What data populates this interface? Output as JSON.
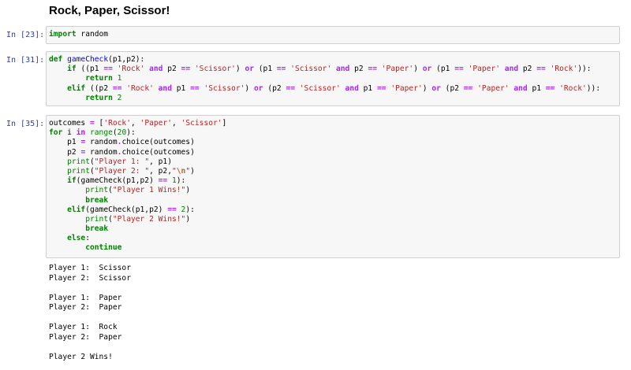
{
  "heading": "Rock, Paper, Scissor!",
  "cells": [
    {
      "prompt": "In [23]:"
    },
    {
      "prompt": "In [31]:"
    },
    {
      "prompt": "In [35]:"
    }
  ],
  "code": {
    "c1": [
      "import",
      " random"
    ],
    "c2": {
      "l1": [
        "def",
        " ",
        "gameCheck",
        "(p1,p2):"
      ],
      "l2": [
        "    ",
        "if",
        " ((p1 ",
        "==",
        " ",
        "'Rock'",
        " ",
        "and",
        " p2 ",
        "==",
        " ",
        "'Scissor'",
        ") ",
        "or",
        " (p1 ",
        "==",
        " ",
        "'Scissor'",
        " ",
        "and",
        " p2 ",
        "==",
        " ",
        "'Paper'",
        ") ",
        "or",
        " (p1 ",
        "==",
        " ",
        "'Paper'",
        " ",
        "and",
        " p2 ",
        "==",
        " ",
        "'Rock'",
        ")):"
      ],
      "l3": [
        "        ",
        "return",
        " ",
        "1"
      ],
      "l4": [
        "    ",
        "elif",
        " ((p2 ",
        "==",
        " ",
        "'Rock'",
        " ",
        "and",
        " p1 ",
        "==",
        " ",
        "'Scissor'",
        ") ",
        "or",
        " (p2 ",
        "==",
        " ",
        "'Scissor'",
        " ",
        "and",
        " p1 ",
        "==",
        " ",
        "'Paper'",
        ") ",
        "or",
        " (p2 ",
        "==",
        " ",
        "'Paper'",
        " ",
        "and",
        " p1 ",
        "==",
        " ",
        "'Rock'",
        ")):"
      ],
      "l5": [
        "        ",
        "return",
        " ",
        "2"
      ]
    },
    "c3": {
      "l1": [
        "outcomes ",
        "=",
        " [",
        "'Rock'",
        ", ",
        "'Paper'",
        ", ",
        "'Scissor'",
        "]"
      ],
      "l2": [
        "for",
        " i ",
        "in",
        " ",
        "range",
        "(",
        "20",
        "):"
      ],
      "l3": [
        "    p1 ",
        "=",
        " random",
        ".",
        "choice(outcomes)"
      ],
      "l4": [
        "    p2 ",
        "=",
        " random",
        ".",
        "choice(outcomes)"
      ],
      "l5": [
        "    ",
        "print",
        "(",
        "\"Player 1: \"",
        ", p1)"
      ],
      "l6": [
        "    ",
        "print",
        "(",
        "\"Player 2: \"",
        ", p2,",
        "\"",
        "\\n",
        "\"",
        ")"
      ],
      "l7": [
        "    ",
        "if",
        "(gameCheck(p1,p2) ",
        "==",
        " ",
        "1",
        "):"
      ],
      "l8": [
        "        ",
        "print",
        "(",
        "\"Player 1 Wins!\"",
        ")"
      ],
      "l9": [
        "        ",
        "break"
      ],
      "l10": [
        "    ",
        "elif",
        "(gameCheck(p1,p2) ",
        "==",
        " ",
        "2",
        "):"
      ],
      "l11": [
        "        ",
        "print",
        "(",
        "\"Player 2 Wins!\"",
        ")"
      ],
      "l12": [
        "        ",
        "break"
      ],
      "l13": [
        "    ",
        "else",
        ":"
      ],
      "l14": [
        "        ",
        "continue"
      ]
    }
  },
  "output": [
    "Player 1:  Scissor",
    "Player 2:  Scissor",
    "",
    "Player 1:  Paper",
    "Player 2:  Paper",
    "",
    "Player 1:  Rock",
    "Player 2:  Paper",
    "",
    "Player 2 Wins!"
  ]
}
